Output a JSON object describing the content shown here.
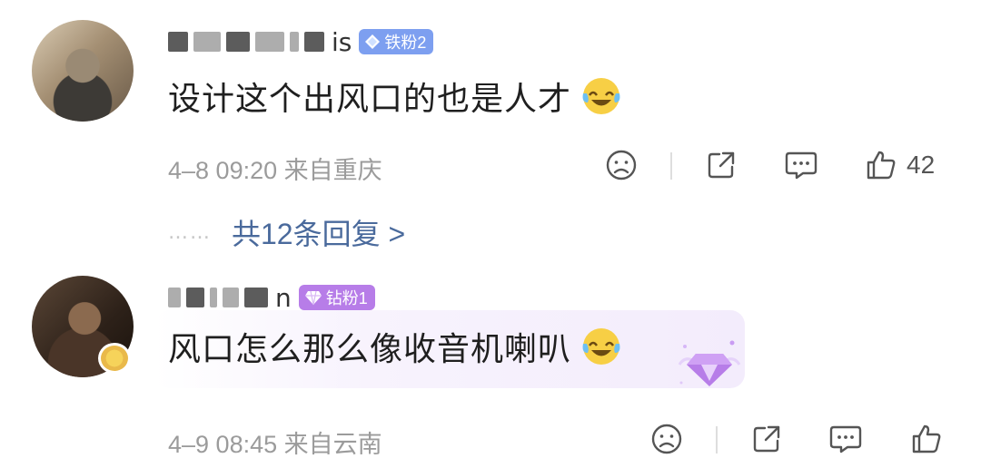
{
  "comments": [
    {
      "name_visible_suffix": "is",
      "badge": {
        "label": "铁粉2",
        "color": "#7d9ff0",
        "icon": "diamond-icon"
      },
      "text": "设计这个出风口的也是人才",
      "emoji": "laugh-cry-emoji",
      "date": "4–8 09:20 来自重庆",
      "like_count": "42",
      "replies_link": "共12条回复 >",
      "reply_dots": "……"
    },
    {
      "name_visible_suffix": "n",
      "badge": {
        "label": "钻粉1",
        "color": "#b77de8",
        "icon": "gem-icon"
      },
      "text": "风口怎么那么像收音机喇叭",
      "emoji": "laugh-cry-emoji",
      "date": "4–9 08:45 来自云南",
      "like_count": ""
    }
  ],
  "icons": {
    "dislike": "frown-face-icon",
    "share": "share-icon",
    "comment": "comment-bubble-icon",
    "like": "thumbs-up-icon"
  }
}
